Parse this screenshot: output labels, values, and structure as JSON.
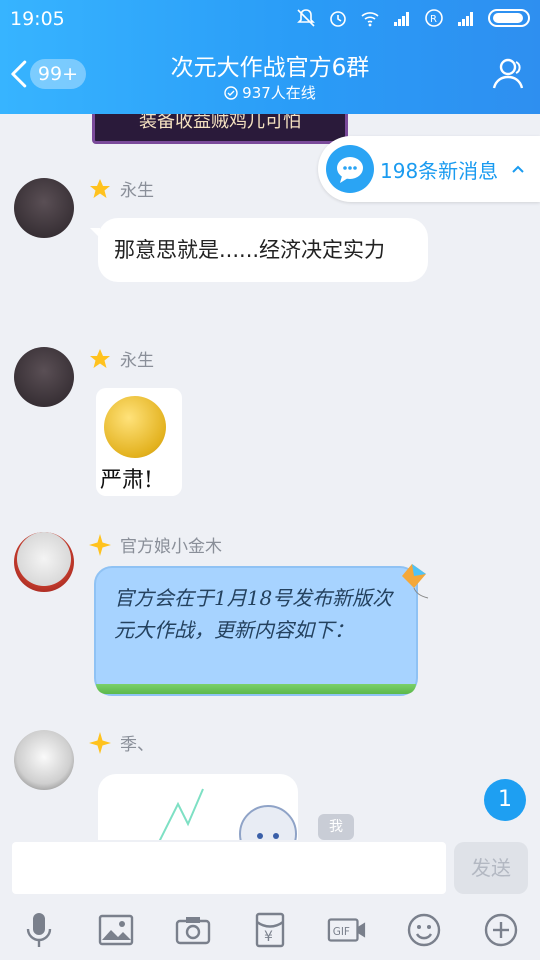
{
  "status_bar": {
    "time": "19:05"
  },
  "header": {
    "back_badge": "99+",
    "title": "次元大作战官方6群",
    "online": "937人在线"
  },
  "banner_image_text": "装备收益贼鸡儿可怕",
  "new_messages": {
    "label": "198条新消息"
  },
  "messages": [
    {
      "sender": "永生",
      "text": "那意思就是......经济决定实力"
    },
    {
      "sender": "永生",
      "sticker_text": "严肃!"
    },
    {
      "sender": "官方娘小金木",
      "text": "官方会在于1月18号发布新版次元大作战，更新内容如下："
    },
    {
      "sender": "季、"
    }
  ],
  "me_label": "我",
  "unread_count": "1",
  "composer": {
    "send_label": "发送"
  },
  "toolbar": {
    "items": [
      "microphone-icon",
      "image-icon",
      "camera-icon",
      "red-packet-icon",
      "gif-icon",
      "emoji-icon",
      "plus-icon"
    ]
  },
  "colors": {
    "accent": "#2a9cf7",
    "bubble_blue": "#a7d3ff"
  }
}
